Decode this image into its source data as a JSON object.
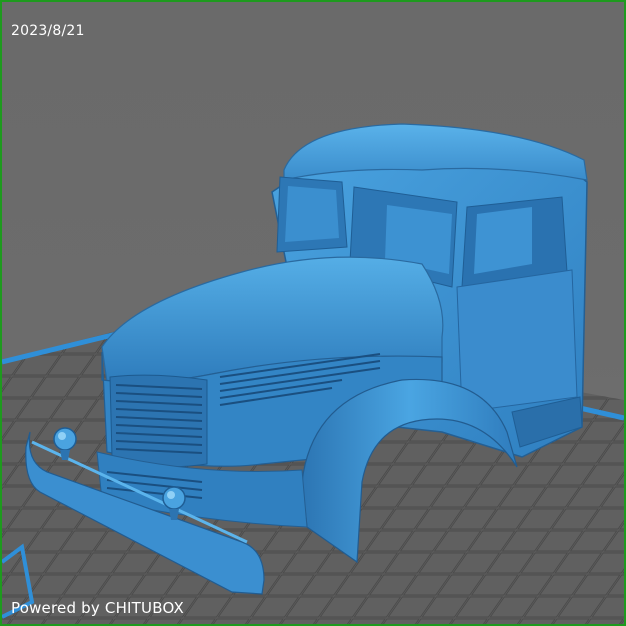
{
  "viewport": {
    "date": "2023/8/21",
    "watermark": "Powered by CHITUBOX"
  },
  "colors": {
    "background": "#6c6c6c",
    "frame": "#1e9a1e",
    "model": "#3a8fd0",
    "build_plate": "#5a5a5a",
    "plate_edge": "#2f8fd8"
  },
  "scene": {
    "model_icon": "truck-cab-model-icon",
    "plate_icon": "build-plate-grid-icon"
  }
}
